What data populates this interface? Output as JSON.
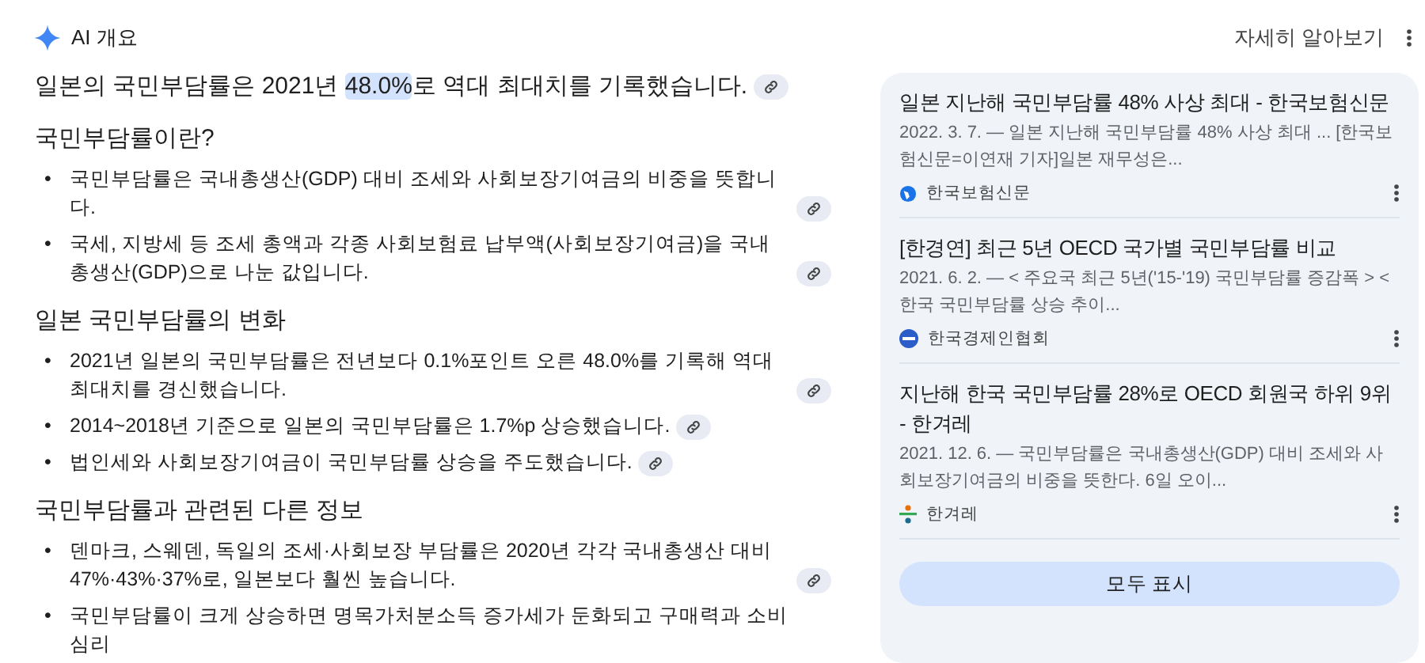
{
  "header": {
    "title": "AI 개요",
    "learn_more": "자세히 알아보기"
  },
  "headline": [
    {
      "text": "일본의 국민부담률은 2021년 ",
      "highlighted": false
    },
    {
      "text": "48.0%",
      "highlighted": true
    },
    {
      "text": "로 역대 최대치를 기록했습니다.",
      "highlighted": false
    }
  ],
  "headline_link": true,
  "sections": [
    {
      "heading": "국민부담률이란?",
      "bullets": [
        {
          "bullet": "•",
          "text": "국민부담률은 국내총생산(GDP) 대비 조세와 사회보장기여금의 비중을 뜻합니다.",
          "link": true
        },
        {
          "bullet": "•",
          "text": "국세, 지방세 등 조세 총액과 각종 사회보험료 납부액(사회보장기여금)을 국내총생산(GDP)으로 나눈 값입니다.",
          "link": true
        }
      ]
    },
    {
      "heading": "일본 국민부담률의 변화",
      "bullets": [
        {
          "bullet": "•",
          "text": "2021년 일본의 국민부담률은 전년보다 0.1%포인트 오른 48.0%를 기록해 역대 최대치를 경신했습니다.",
          "link": true
        },
        {
          "bullet": "•",
          "text": "2014~2018년 기준으로 일본의 국민부담률은 1.7%p 상승했습니다.",
          "link": true
        },
        {
          "bullet": "•",
          "text": "법인세와 사회보장기여금이 국민부담률 상승을 주도했습니다.",
          "link": true
        }
      ]
    },
    {
      "heading": "국민부담률과 관련된 다른 정보",
      "bullets": [
        {
          "bullet": "•",
          "text": "덴마크, 스웨덴, 독일의 조세·사회보장 부담률은 2020년 각각 국내총생산 대비 47%·43%·37%로, 일본보다 훨씬 높습니다.",
          "link": true
        },
        {
          "bullet": "•",
          "text": "국민부담률이 크게 상승하면 명목가처분소득 증가세가 둔화되고 구매력과 소비심리"
        }
      ]
    }
  ],
  "sources": [
    {
      "title": "일본 지난해 국민부담률 48% 사상 최대 - 한국보험신문",
      "snippet": "2022. 3. 7. — 일본 지난해 국민부담률 48% 사상 최대 ... [한국보험신문=이연재 기자]일본 재무성은...",
      "site": "한국보험신문",
      "kind": "globe"
    },
    {
      "title": "[한경연] 최근 5년 OECD 국가별 국민부담률 비교",
      "snippet": "2021. 6. 2. — < 주요국 최근 5년('15-'19) 국민부담률 증감폭 > < 한국 국민부담률 상승 추이...",
      "site": "한국경제인협회",
      "kind": "disc"
    },
    {
      "title": "지난해 한국 국민부담률 28%로 OECD 회원국 하위 9위 - 한겨레",
      "snippet": "2021. 12. 6. — 국민부담률은 국내총생산(GDP) 대비 조세와 사회보장기여금의 비중을 뜻한다. 6일 오이...",
      "site": "한겨레",
      "kind": "split"
    }
  ],
  "show_all": "모두 표시"
}
